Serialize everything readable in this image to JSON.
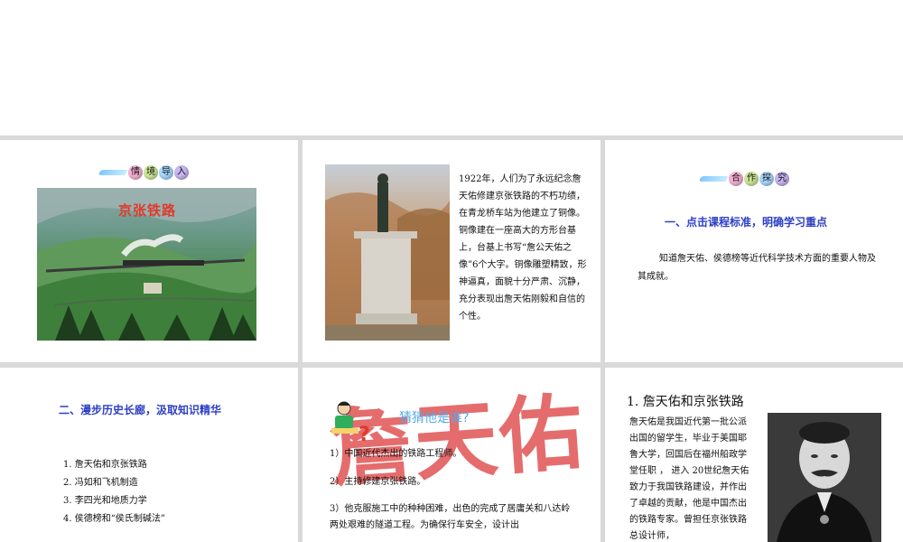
{
  "slide1": {
    "badge": [
      "情",
      "境",
      "导",
      "入"
    ],
    "image_title": "京张铁路"
  },
  "slide2": {
    "paragraph": "1922年，人们为了永远纪念詹天佑修建京张铁路的不朽功绩，在青龙桥车站为他建立了铜像。铜像建在一座高大的方形台基上，台基上书写“詹公天佑之像”6个大字。铜像雕塑精致，形神逼真，面貌十分严肃、沉静，充分表现出詹天佑刚毅和自信的个性。"
  },
  "slide3": {
    "badge": [
      "合",
      "作",
      "探",
      "究"
    ],
    "heading": "一、点击课程标准，明确学习重点",
    "paragraph": "知道詹天佑、侯德榜等近代科学技术方面的重要人物及其成就。"
  },
  "slide4": {
    "heading": "二、漫步历史长廊，汲取知识精华",
    "items": [
      "1. 詹天佑和京张铁路",
      "2. 冯如和飞机制造",
      "3. 李四光和地质力学",
      "4. 侯德榜和“侯氏制碱法”"
    ]
  },
  "slide5": {
    "heading": "猜猜他是谁?",
    "question_mark": "?",
    "big_name": "詹天佑",
    "clues": [
      "1）中国近代杰出的铁路工程师。",
      "2）主持修建京张铁路。",
      "3）他克服施工中的种种困难，出色的完成了居庸关和八达岭两处艰难的隧道工程。为确保行车安全，设计出"
    ]
  },
  "slide6": {
    "heading": "1. 詹天佑和京张铁路",
    "paragraph": "詹天佑是我国近代第一批公派出国的留学生，毕业于美国耶鲁大学，回国后在福州船政学堂任职 ， 进入 20世纪詹天佑致力于我国铁路建设，并作出了卓越的贡献，他是中国杰出的铁路专家。曾担任京张铁路总设计师，"
  },
  "colors": {
    "heading_blue": "#2d3fc4",
    "title_red": "#e03a2a",
    "name_red": "#e05252",
    "guess_blue": "#56a9e6",
    "bubble_1": "#f7b2d6",
    "bubble_2": "#cfe89a",
    "bubble_3": "#a8d8ff",
    "bubble_4": "#c8b6f2"
  }
}
